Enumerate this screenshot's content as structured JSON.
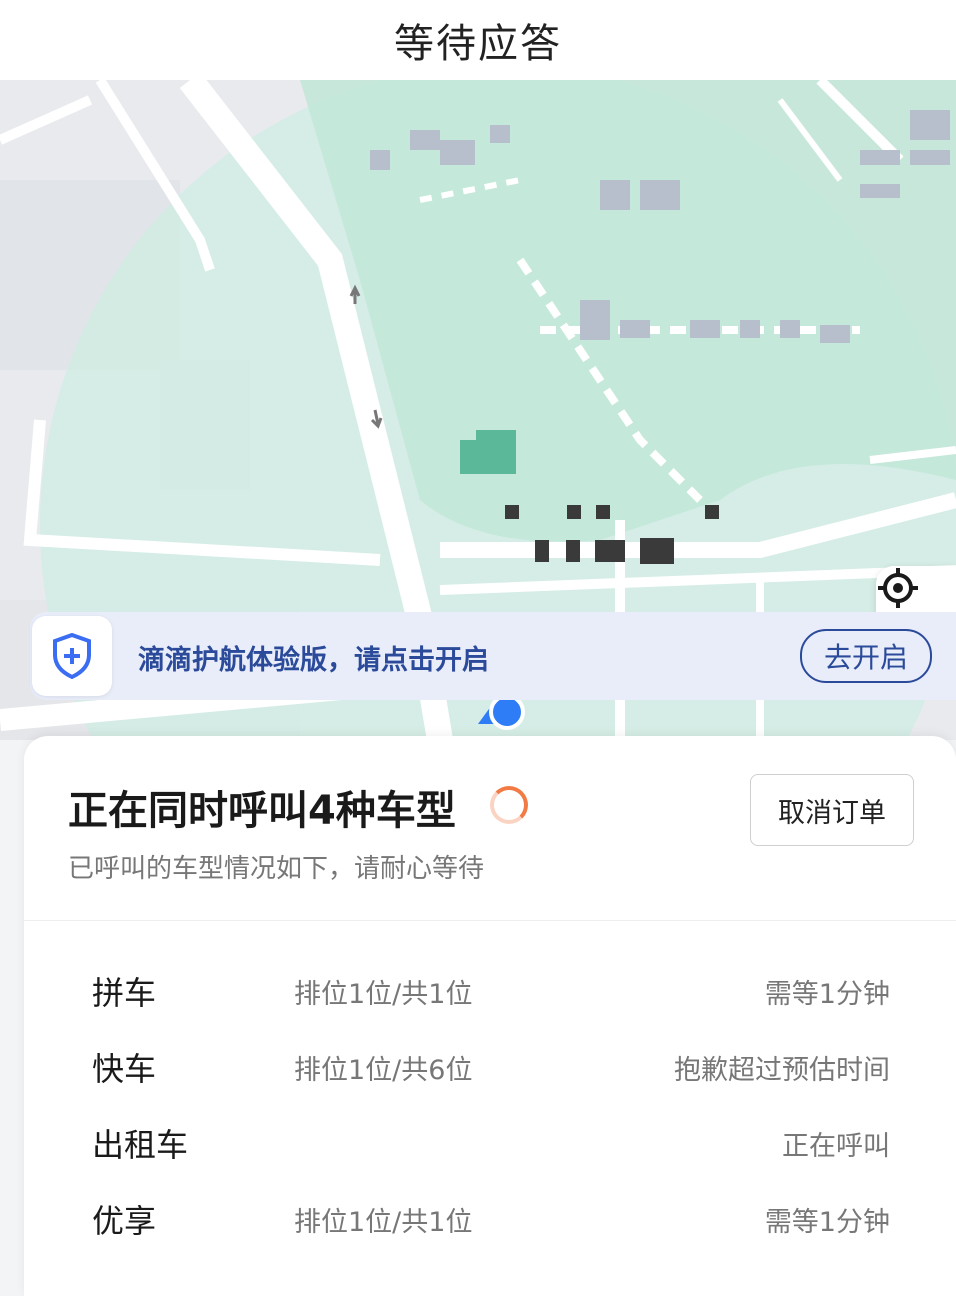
{
  "header": {
    "title": "等待应答"
  },
  "map": {
    "locate_icon": "locate-crosshair-icon"
  },
  "banner": {
    "icon": "shield-plus-icon",
    "text": "滴滴护航体验版，请点击开启",
    "button_label": "去开启",
    "accent": "#2b4a9a"
  },
  "status": {
    "title": "正在同时呼叫4种车型",
    "subtitle": "已呼叫的车型情况如下，请耐心等待",
    "cancel_label": "取消订单",
    "spinner_color": "#f27b45"
  },
  "car_types": [
    {
      "name": "拼车",
      "queue": "排位1位/共1位",
      "wait": "需等1分钟"
    },
    {
      "name": "快车",
      "queue": "排位1位/共6位",
      "wait": "抱歉超过预估时间"
    },
    {
      "name": "出租车",
      "queue": "",
      "wait": "正在呼叫"
    },
    {
      "name": "优享",
      "queue": "排位1位/共1位",
      "wait": "需等1分钟"
    }
  ]
}
